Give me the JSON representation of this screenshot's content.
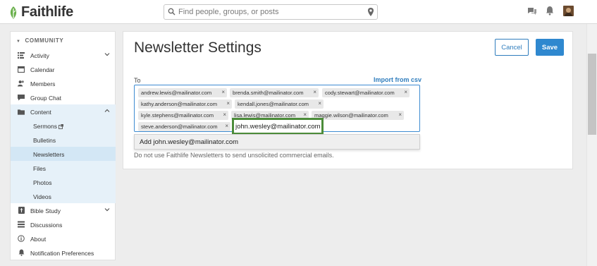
{
  "app": {
    "name": "Faithlife"
  },
  "search": {
    "placeholder": "Find people, groups, or posts"
  },
  "sidebar": {
    "section_title": "COMMUNITY",
    "items": [
      {
        "label": "Activity",
        "icon": "activity-icon"
      },
      {
        "label": "Calendar",
        "icon": "calendar-icon"
      },
      {
        "label": "Members",
        "icon": "members-icon"
      },
      {
        "label": "Group Chat",
        "icon": "chat-icon"
      },
      {
        "label": "Content",
        "icon": "folder-icon"
      },
      {
        "label": "Sermons",
        "icon": "external-link-icon"
      },
      {
        "label": "Bulletins"
      },
      {
        "label": "Newsletters"
      },
      {
        "label": "Files"
      },
      {
        "label": "Photos"
      },
      {
        "label": "Videos"
      },
      {
        "label": "Bible Study",
        "icon": "bible-icon"
      },
      {
        "label": "Discussions",
        "icon": "discussions-icon"
      },
      {
        "label": "About",
        "icon": "info-icon"
      },
      {
        "label": "Notification Preferences",
        "icon": "bell-icon"
      }
    ]
  },
  "page": {
    "title": "Newsletter Settings",
    "cancel_label": "Cancel",
    "save_label": "Save",
    "to_label": "To",
    "import_label": "Import from csv",
    "recipients": [
      "andrew.lewis@mailinator.com",
      "brenda.smith@mailinator.com",
      "cody.stewart@mailinator.com",
      "kathy.anderson@mailinator.com",
      "kendall.jones@mailinator.com",
      "kyle.stephens@mailinator.com",
      "lisa.lewis@mailinator.com",
      "maggie.wilson@mailinator.com",
      "steve.anderson@mailinator.com"
    ],
    "input_value": "john.wesley@mailinator.com",
    "suggestion": "Add john.wesley@mailinator.com",
    "disclaimer": "Do not use Faithlife Newsletters to send unsolicited commercial emails."
  },
  "colors": {
    "accent": "#2f88cf",
    "link": "#2f7dbd",
    "brand_green": "#6ab04c",
    "highlight": "#4c8c3a"
  }
}
